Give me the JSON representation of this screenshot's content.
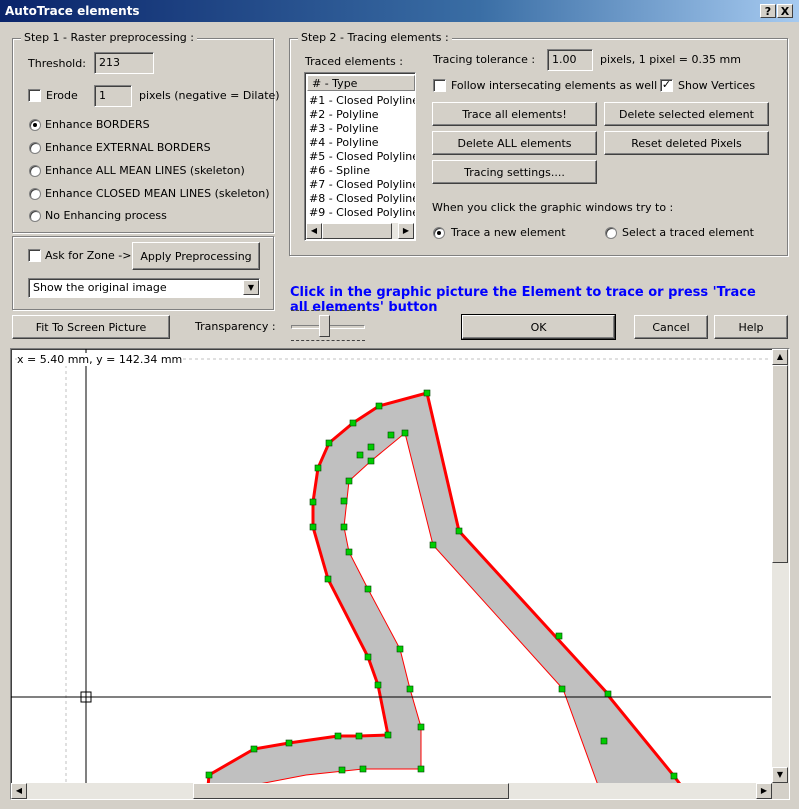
{
  "window": {
    "title": "AutoTrace elements",
    "help_btn": "?",
    "close_btn": "X"
  },
  "step1": {
    "legend": "Step 1 - Raster preprocessing :",
    "threshold_label": "Threshold:",
    "threshold_value": "213",
    "erode_label": "Erode",
    "erode_checked": false,
    "erode_value": "1",
    "erode_units": "pixels (negative = Dilate)",
    "options": [
      {
        "label": "Enhance BORDERS",
        "selected": true
      },
      {
        "label": "Enhance EXTERNAL BORDERS",
        "selected": false
      },
      {
        "label": "Enhance ALL MEAN LINES (skeleton)",
        "selected": false
      },
      {
        "label": "Enhance CLOSED MEAN LINES (skeleton)",
        "selected": false
      },
      {
        "label": "No Enhancing process",
        "selected": false
      }
    ],
    "ask_zone_label": "Ask for Zone ->",
    "apply_btn": "Apply Preprocessing",
    "show_select": "Show the original image"
  },
  "step2": {
    "legend": "Step 2 - Tracing elements :",
    "traced_label": "Traced elements :",
    "list_header": "# - Type",
    "elements": [
      "#1 - Closed Polyline",
      "#2 - Polyline",
      "#3 - Polyline",
      "#4 - Polyline",
      "#5 - Closed Polyline",
      "#6 - Spline",
      "#7 - Closed Polyline",
      "#8 - Closed Polyline",
      "#9 - Closed Polyline"
    ],
    "tolerance_label": "Tracing tolerance :",
    "tolerance_value": "1.00",
    "tolerance_units": "pixels, 1 pixel = 0.35 mm",
    "follow_label": "Follow intersecating elements as well",
    "follow_checked": false,
    "show_vertices_label": "Show Vertices",
    "show_vertices_checked": true,
    "trace_all_btn": "Trace all elements!",
    "delete_selected_btn": "Delete selected element",
    "delete_all_btn": "Delete ALL elements",
    "reset_btn": "Reset deleted Pixels",
    "settings_btn": "Tracing settings....",
    "click_label": "When you click the graphic windows try to :",
    "trace_new_label": "Trace a new element",
    "trace_new_selected": true,
    "select_traced_label": "Select a traced element",
    "select_traced_selected": false
  },
  "hint": "Click in the graphic picture the Element to trace or press 'Trace all elements' button",
  "toolbar": {
    "fit_btn": "Fit To Screen Picture",
    "transparency_label": "Transparency :",
    "transparency_value": 0.45,
    "ok_btn": "OK",
    "cancel_btn": "Cancel",
    "help_btn": "Help"
  },
  "canvas": {
    "coords": "x = 5.40 mm, y = 142.34 mm",
    "fill_color": "#c0c0c0",
    "stroke_color": "#ff0000",
    "vertex_color": "#00cc00"
  }
}
